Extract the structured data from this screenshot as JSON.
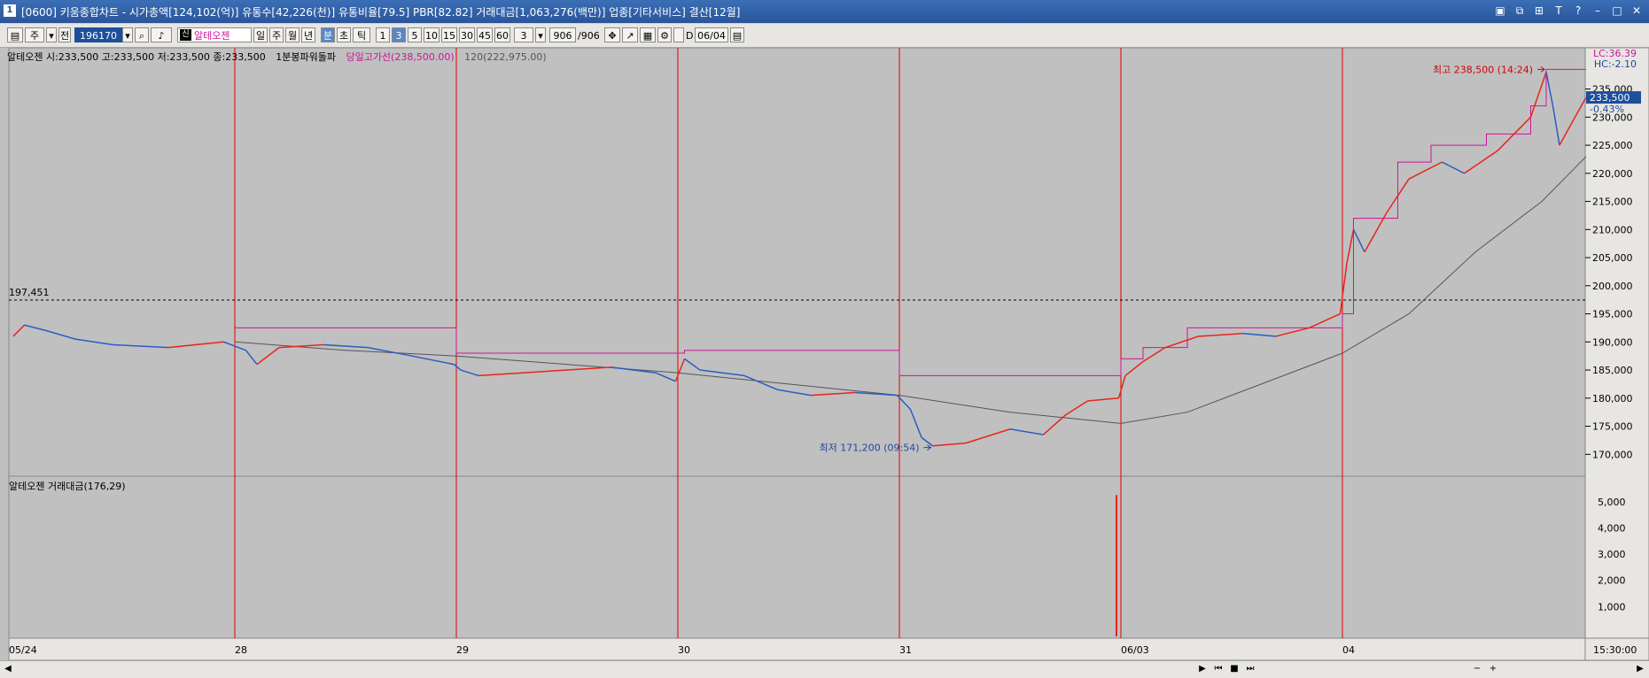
{
  "window": {
    "title": "[0600] 키움종합차트 - 시가총액[124,102(억)] 유통수[42,226(천)] 유통비율[79.5] PBR[82.82] 거래대금[1,063,276(백만)] 업종[기타서비스] 결산[12월]",
    "icon_label": "1"
  },
  "toolbar": {
    "type_label": "주",
    "range_label": "전",
    "code": "196170",
    "stock_name": "알테오젠",
    "stock_badge": "신",
    "period_day": "일",
    "period_week": "주",
    "period_month": "월",
    "period_year": "년",
    "period_min": "분",
    "period_sec": "초",
    "period_tick": "틱",
    "minute_options": [
      "1",
      "3",
      "5",
      "10",
      "15",
      "30",
      "45",
      "60"
    ],
    "minute_custom": "3",
    "count": "906",
    "count_total": "/906",
    "date_prefix": "D",
    "date": "06/04"
  },
  "legend": {
    "price_info": "알테오젠 시:233,500 고:233,500 저:233,500 종:233,500",
    "indicator": "1분봉파워돌파",
    "high_line": "당일고가선(238,500.00)",
    "ma": "120(222,975.00)"
  },
  "lc_hc": {
    "lc": "LC:36.39",
    "hc": "HC:-2.10"
  },
  "volume_legend": "알테오젠 거래대금(176,29)",
  "colors": {
    "up": "#e8241c",
    "down": "#2a5cc4",
    "magenta": "#d0139a",
    "ma": "#555555",
    "background": "#c0c0c0",
    "grid_red": "#e00000"
  },
  "chart_data": {
    "type": "line",
    "title": "",
    "x_labels": [
      "05/24",
      "28",
      "29",
      "30",
      "31",
      "06/03",
      "04"
    ],
    "y_ticks": [
      "170,000",
      "175,000",
      "180,000",
      "185,000",
      "190,000",
      "195,000",
      "200,000",
      "205,000",
      "210,000",
      "215,000",
      "220,000",
      "225,000",
      "230,000",
      "235,000"
    ],
    "ylim": [
      168000,
      239500
    ],
    "reference_line": {
      "label": "197,451",
      "value": 197451
    },
    "current_price": {
      "label": "233,500",
      "change_label": "-0.43%",
      "value": 233500
    },
    "high_annotation": {
      "label": "최고 238,500 (14:24)",
      "value": 238500
    },
    "low_annotation": {
      "label": "최저 171,200 (09:54)",
      "value": 171200
    },
    "time_label": "15:30:00",
    "day_index": [
      0,
      1,
      2,
      3,
      4,
      5,
      6
    ],
    "series": [
      {
        "name": "종가",
        "values": [
          [
            0.0,
            191000
          ],
          [
            0.05,
            193000
          ],
          [
            0.15,
            192000
          ],
          [
            0.28,
            190500
          ],
          [
            0.45,
            189500
          ],
          [
            0.7,
            189000
          ],
          [
            0.95,
            190000
          ],
          [
            1.05,
            188500
          ],
          [
            1.1,
            186000
          ],
          [
            1.2,
            189000
          ],
          [
            1.4,
            189500
          ],
          [
            1.6,
            189000
          ],
          [
            1.8,
            187500
          ],
          [
            1.99,
            186000
          ],
          [
            2.02,
            185000
          ],
          [
            2.1,
            184000
          ],
          [
            2.3,
            184500
          ],
          [
            2.5,
            185000
          ],
          [
            2.7,
            185500
          ],
          [
            2.9,
            184500
          ],
          [
            2.99,
            183000
          ],
          [
            3.03,
            187000
          ],
          [
            3.1,
            185000
          ],
          [
            3.3,
            184000
          ],
          [
            3.45,
            181500
          ],
          [
            3.6,
            180500
          ],
          [
            3.8,
            181000
          ],
          [
            3.99,
            180500
          ],
          [
            4.05,
            178000
          ],
          [
            4.1,
            173000
          ],
          [
            4.15,
            171500
          ],
          [
            4.3,
            172000
          ],
          [
            4.5,
            174500
          ],
          [
            4.65,
            173500
          ],
          [
            4.75,
            177000
          ],
          [
            4.85,
            179500
          ],
          [
            4.99,
            180000
          ],
          [
            5.02,
            184000
          ],
          [
            5.1,
            186500
          ],
          [
            5.2,
            189000
          ],
          [
            5.35,
            191000
          ],
          [
            5.55,
            191500
          ],
          [
            5.7,
            191000
          ],
          [
            5.85,
            192500
          ],
          [
            5.99,
            195000
          ],
          [
            6.02,
            204000
          ],
          [
            6.05,
            210000
          ],
          [
            6.1,
            206000
          ],
          [
            6.2,
            213000
          ],
          [
            6.3,
            219000
          ],
          [
            6.45,
            222000
          ],
          [
            6.55,
            220000
          ],
          [
            6.7,
            224000
          ],
          [
            6.85,
            230000
          ],
          [
            6.92,
            238000
          ],
          [
            6.95,
            232000
          ],
          [
            6.98,
            225000
          ],
          [
            7.05,
            230000
          ],
          [
            7.1,
            233500
          ]
        ]
      },
      {
        "name": "120",
        "values": [
          [
            1.0,
            190000
          ],
          [
            1.5,
            188500
          ],
          [
            2.0,
            187500
          ],
          [
            2.5,
            186000
          ],
          [
            3.0,
            184500
          ],
          [
            3.5,
            182500
          ],
          [
            4.0,
            180500
          ],
          [
            4.5,
            177500
          ],
          [
            5.0,
            175500
          ],
          [
            5.3,
            177500
          ],
          [
            5.6,
            182000
          ],
          [
            6.0,
            188000
          ],
          [
            6.3,
            195000
          ],
          [
            6.6,
            206000
          ],
          [
            6.9,
            215000
          ],
          [
            7.1,
            222975
          ]
        ]
      },
      {
        "name": "당일고가선",
        "values": [
          [
            1.0,
            192500
          ],
          [
            2.0,
            188000
          ],
          [
            3.03,
            188500
          ],
          [
            4.0,
            184000
          ],
          [
            5.0,
            187000
          ],
          [
            5.1,
            189000
          ],
          [
            5.3,
            192500
          ],
          [
            6.0,
            195000
          ],
          [
            6.05,
            212000
          ],
          [
            6.25,
            222000
          ],
          [
            6.4,
            225000
          ],
          [
            6.65,
            227000
          ],
          [
            6.85,
            232000
          ],
          [
            6.92,
            238500
          ],
          [
            7.1,
            238500
          ]
        ]
      }
    ],
    "volume": {
      "y_ticks": [
        "1,000",
        "2,000",
        "3,000",
        "4,000",
        "5,000"
      ],
      "ylim": [
        0,
        5500
      ],
      "spike": {
        "x": 4.98,
        "value": 5250
      }
    }
  }
}
